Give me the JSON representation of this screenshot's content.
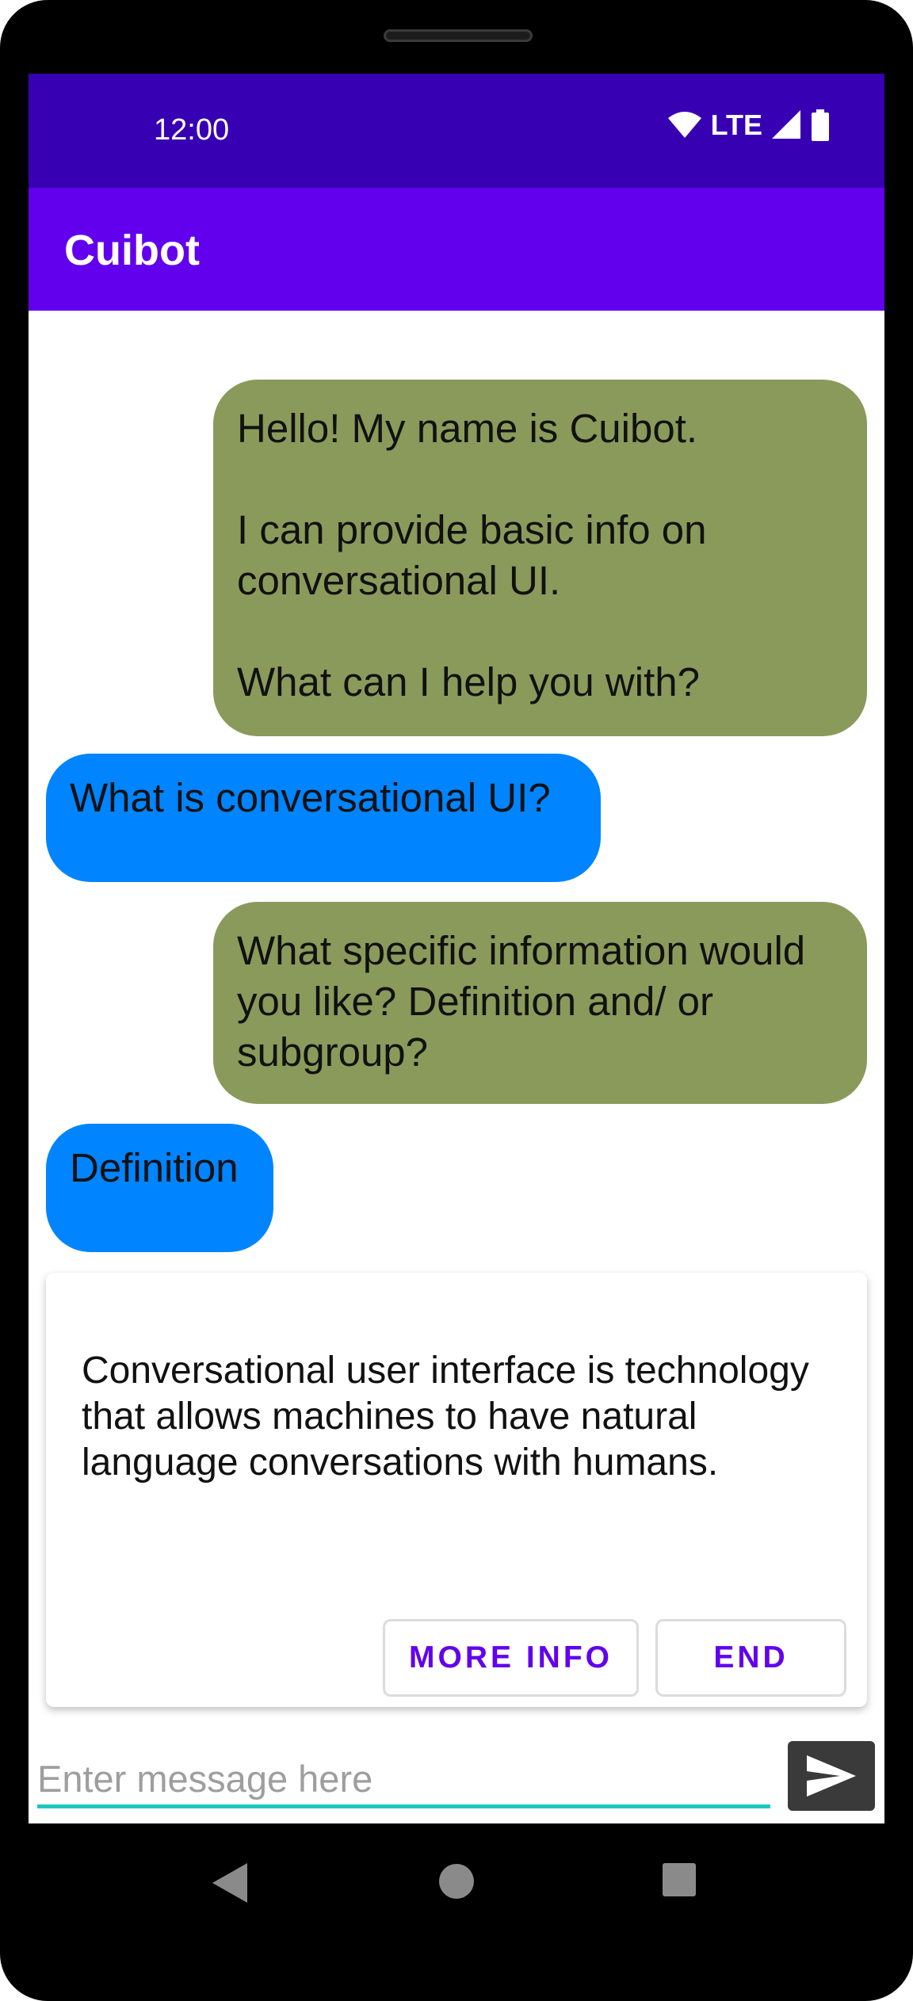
{
  "status_bar": {
    "time": "12:00",
    "network": "LTE",
    "icons": [
      "wifi-icon",
      "signal-icon",
      "battery-icon"
    ]
  },
  "app_bar": {
    "title": "Cuibot"
  },
  "messages": [
    {
      "sender": "bot",
      "text": "Hello! My name is Cuibot.\n\nI can provide basic info on conversational UI.\n\nWhat can I help you with?"
    },
    {
      "sender": "user",
      "text": "What is conversational UI?"
    },
    {
      "sender": "bot",
      "text": "What specific information would you like? Definition and/ or subgroup?"
    },
    {
      "sender": "user",
      "text": "Definition"
    }
  ],
  "card": {
    "text": "Conversational user interface is technology that allows machines to have natural language conversations with humans.",
    "buttons": [
      "MORE INFO",
      "END"
    ]
  },
  "composer": {
    "placeholder": "Enter message here",
    "send_icon": "send-icon"
  },
  "colors": {
    "status_bar": "#3700b3",
    "app_bar": "#6200ee",
    "bot_bubble": "#8a9a5b",
    "user_bubble": "#0084ff",
    "input_underline": "#1cc9c0"
  },
  "nav_bar": {
    "icons": [
      "back-icon",
      "home-icon",
      "recents-icon"
    ]
  }
}
